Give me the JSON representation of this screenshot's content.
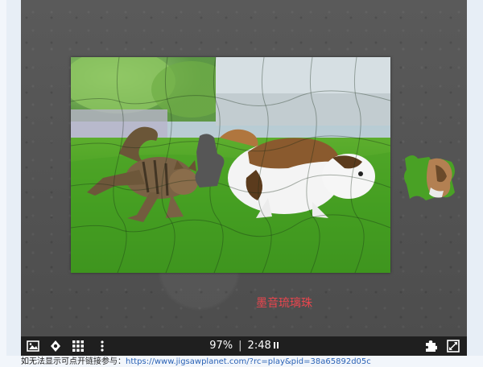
{
  "caption": "墨音琉璃珠",
  "status": {
    "progress_text": "97%",
    "separator": "|",
    "timer": "2:48"
  },
  "toolbar": {
    "left_icons": [
      "image-icon",
      "shapes-icon",
      "grid-icon",
      "more-icon"
    ],
    "right_icons": [
      "puzzle-piece-icon",
      "fullscreen-icon"
    ]
  },
  "footer": {
    "text": "如无法显示可点开链接参与：",
    "link": "https://www.jigsawplanet.com/?rc=play&pid=38a65892d05c"
  },
  "colors": {
    "caption": "#e8464e",
    "toolbar": "#1f1f1f",
    "link": "#2a62b6",
    "board": "#555555"
  }
}
